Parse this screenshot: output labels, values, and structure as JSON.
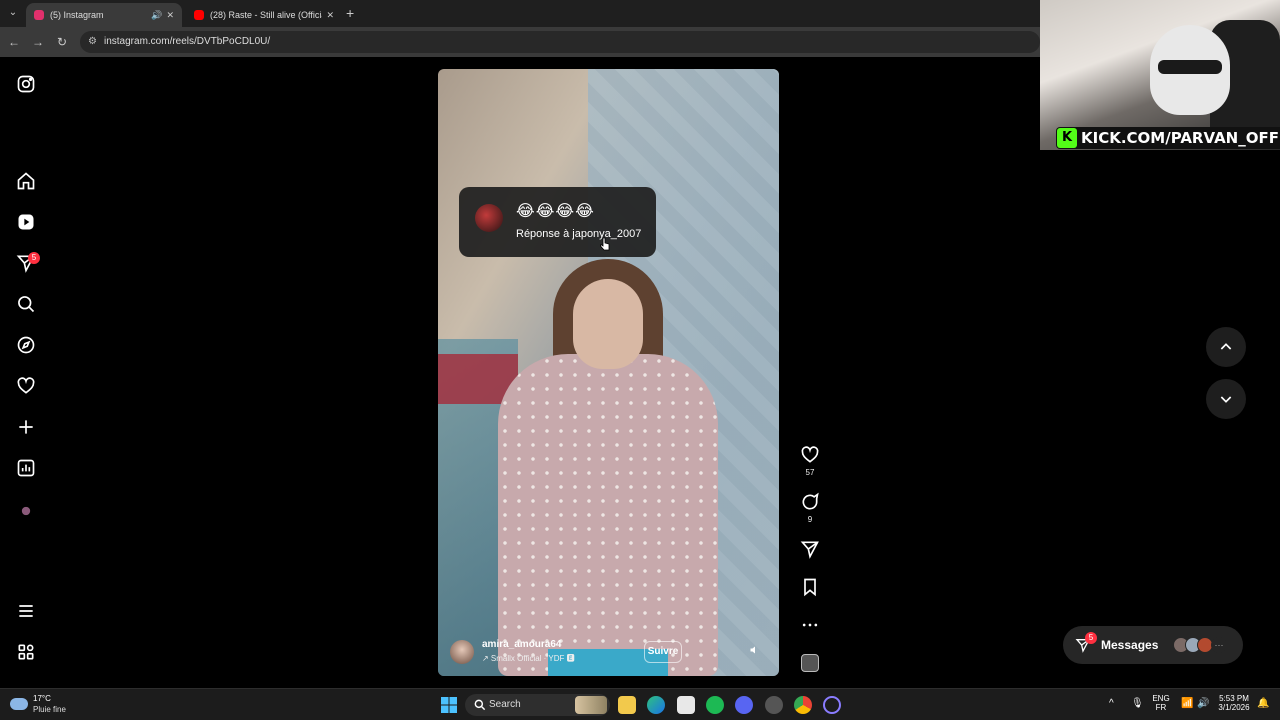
{
  "browser": {
    "tabs": [
      {
        "title": "(5) Instagram",
        "favicon_color": "#e1306c",
        "active": true
      },
      {
        "title": "(28) Raste - Still alive (Official ly",
        "favicon_color": "#ff0000",
        "active": false
      }
    ],
    "url": "instagram.com/reels/DVTbPoCDL0U/"
  },
  "overlay": {
    "kick_text": "KICK.COM/PARVAN_OFF"
  },
  "leftnav": {
    "notifications_badge": "5"
  },
  "reel": {
    "reply": {
      "emojis": "😂😂😂😂",
      "text": "Réponse à japonya_2007"
    },
    "author": {
      "username": "amira_amoura64",
      "music": "↗ Smallx Official · YDF 🅴",
      "follow_label": "Suivre"
    },
    "likes": "57",
    "comments": "9"
  },
  "messages": {
    "label": "Messages",
    "badge": "5"
  },
  "taskbar": {
    "temperature": "17°C",
    "condition": "Pluie fine",
    "search_label": "Search",
    "lang_top": "ENG",
    "lang_bottom": "FR",
    "time": "5:53 PM",
    "date": "3/1/2026"
  }
}
